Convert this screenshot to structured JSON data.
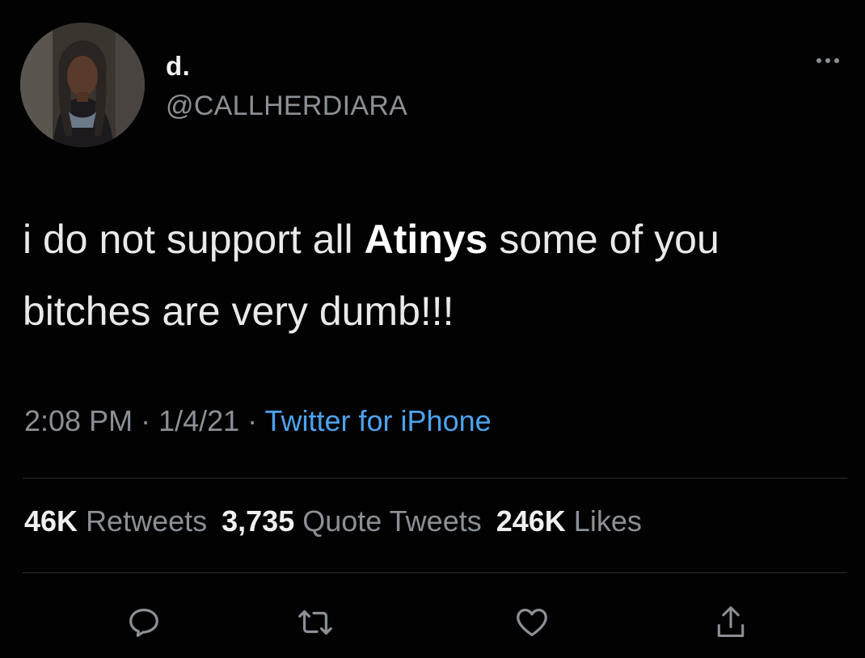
{
  "user": {
    "display_name": "d.",
    "handle": "@CALLHERDIARA"
  },
  "tweet": {
    "text_before": "i do not support all",
    "emphasis": "Atinys",
    "text_after": "some of you bitches are very dumb!!!"
  },
  "meta": {
    "time": "2:08 PM",
    "sep1": " · ",
    "date": "1/4/21",
    "sep2": " · ",
    "source": "Twitter for iPhone"
  },
  "stats": {
    "retweets_count": "46K",
    "retweets_label": "Retweets",
    "quotes_count": "3,735",
    "quotes_label": "Quote Tweets",
    "likes_count": "246K",
    "likes_label": "Likes"
  },
  "icons": {
    "reply": "reply-icon",
    "retweet": "retweet-icon",
    "like": "heart-icon",
    "share": "share-icon",
    "more": "more-icon"
  },
  "colors": {
    "background": "#020202",
    "text": "#e9e9e9",
    "secondary": "#8b9095",
    "link": "#4da3ef"
  }
}
